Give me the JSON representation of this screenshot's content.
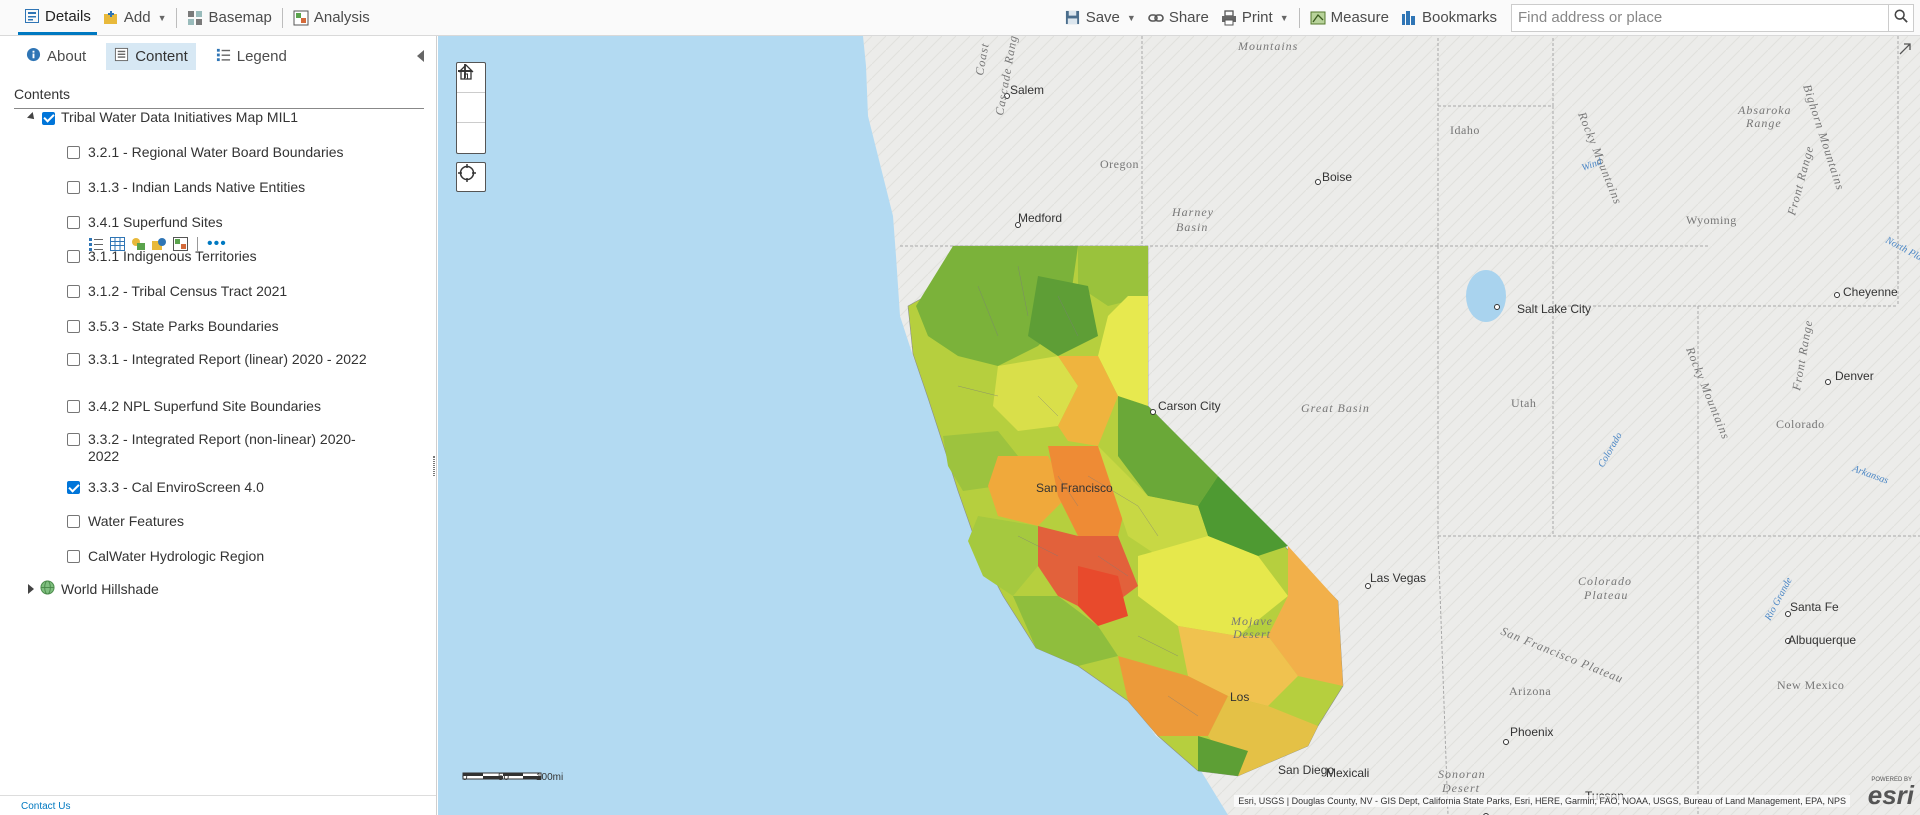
{
  "toolbar": {
    "details_label": "Details",
    "add_label": "Add",
    "basemap_label": "Basemap",
    "analysis_label": "Analysis",
    "save_label": "Save",
    "share_label": "Share",
    "print_label": "Print",
    "measure_label": "Measure",
    "bookmarks_label": "Bookmarks",
    "search_placeholder": "Find address or place"
  },
  "panel": {
    "tabs": [
      {
        "label": "About",
        "icon": "info-icon"
      },
      {
        "label": "Content",
        "icon": "content-icon",
        "active": true
      },
      {
        "label": "Legend",
        "icon": "legend-icon"
      }
    ],
    "contents_header": "Contents",
    "group": {
      "label": "Tribal Water Data Initiatives Map MIL1",
      "checked": true,
      "expanded": true
    },
    "layers": [
      {
        "label": "3.2.1 - Regional Water Board Boundaries",
        "checked": false
      },
      {
        "label": "3.1.3 - Indian Lands Native Entities",
        "checked": false
      },
      {
        "label": "3.4.1 Superfund Sites",
        "checked": false
      },
      {
        "label": "3.1.1 Indigenous Territories",
        "checked": false
      },
      {
        "label": "3.1.2 - Tribal Census Tract 2021",
        "checked": false
      },
      {
        "label": "3.5.3 - State Parks Boundaries",
        "checked": false
      },
      {
        "label": "3.3.1 - Integrated Report (linear) 2020 - 2022",
        "checked": false
      },
      {
        "label": "3.4.2 NPL Superfund Site Boundaries",
        "checked": false
      },
      {
        "label": "3.3.2 - Integrated Report (non-linear) 2020-2022",
        "checked": false
      },
      {
        "label": "3.3.3 - Cal EnviroScreen 4.0",
        "checked": true
      },
      {
        "label": "Water Features",
        "checked": false
      },
      {
        "label": "CalWater Hydrologic Region",
        "checked": false
      }
    ],
    "basemap_group": {
      "label": "World Hillshade",
      "expanded": false
    },
    "footer_link": "Contact Us"
  },
  "map": {
    "cities": {
      "salem": "Salem",
      "boise": "Boise",
      "medford": "Medford",
      "carson": "Carson City",
      "slc": "Salt Lake City",
      "cheyenne": "Cheyenne",
      "denver": "Denver",
      "lasvegas": "Las Vegas",
      "santafe": "Santa Fe",
      "albuquerque": "Albuquerque",
      "phoenix": "Phoenix",
      "sanfrancisco": "San Francisco",
      "losangeles": "Los",
      "sandiego": "San Diego",
      "mexicali": "Mexicali",
      "tucson": "Tucson"
    },
    "regions": {
      "oregon": "Oregon",
      "idaho": "Idaho",
      "wyoming": "Wyoming",
      "utah": "Utah",
      "colorado": "Colorado",
      "arizona": "Arizona",
      "newmexico": "New Mexico",
      "greatbasin": "Great Basin",
      "harney1": "Harney",
      "harney2": "Basin",
      "coloradoplateau1": "Colorado",
      "coloradoplateau2": "Plateau",
      "sonoran1": "Sonoran",
      "sonoran2": "Desert",
      "mojave1": "Mojave",
      "mojave2": "Desert",
      "rocky": "Rocky Mountains",
      "sfplateau": "San Francisco Plateau",
      "mountains": "Mountains",
      "absaroka1": "Absaroka",
      "absaroka2": "Range",
      "bighorn": "Bighorn Mountains",
      "frontrange": "Front Range",
      "northplatte": "North Pla",
      "cascade": "Cascade Range",
      "coast": "Coast",
      "wind": "Wind",
      "colorado_river": "Colorado",
      "arkansas": "Arkansas",
      "riogrande": "Rio Grande"
    },
    "scale_label": "100mi",
    "scale_ticks": [
      "0",
      "50"
    ],
    "attribution": "Esri, USGS | Douglas County, NV - GIS Dept, California State Parks, Esri, HERE, Garmin, FAO, NOAA, USGS, Bureau of Land Management, EPA, NPS",
    "brand": "esri",
    "powered_by": "POWERED BY",
    "colors": {
      "ocean": "#b3daf2",
      "land": "#ececea",
      "lake": "#a9d3ee",
      "accent": "#0079c1",
      "ces_low": "#4ea133",
      "ces_mid": "#dfe34a",
      "ces_high": "#e8532b"
    }
  }
}
